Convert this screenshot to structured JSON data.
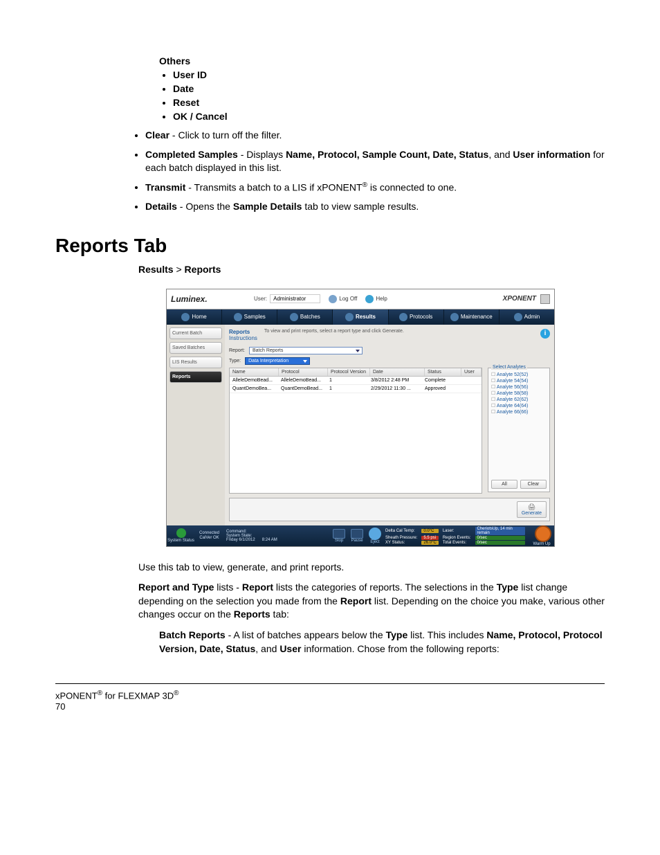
{
  "others": {
    "heading": "Others",
    "items": [
      "User ID",
      "Date",
      "Reset",
      "OK / Cancel"
    ]
  },
  "bullets": {
    "clear_label": "Clear",
    "clear_text": " - Click to turn off the filter.",
    "completed_label": "Completed Samples",
    "completed_pre": " - Displays ",
    "completed_fields": "Name, Protocol, Sample Count, Date, Status",
    "completed_and": ", and ",
    "completed_userinfo": "User information",
    "completed_tail": " for each batch displayed in this list.",
    "transmit_label": "Transmit",
    "transmit_pre": " - Transmits a batch to a LIS if xPONENT",
    "transmit_tail": " is connected to one.",
    "details_label": "Details",
    "details_pre": " - Opens the ",
    "details_tab": "Sample Details",
    "details_tail": " tab to view sample results."
  },
  "heading": "Reports Tab",
  "breadcrumb": {
    "a": "Results",
    "sep": " > ",
    "b": "Reports"
  },
  "app": {
    "logo": "Luminex",
    "user_label": "User:",
    "user_value": "Administrator",
    "logoff": "Log Off",
    "help": "Help",
    "brand": "XPONENT",
    "tabs": [
      "Home",
      "Samples",
      "Batches",
      "Results",
      "Protocols",
      "Maintenance",
      "Admin"
    ],
    "active_tab_index": 3,
    "sidebar": [
      "Current Batch",
      "Saved Batches",
      "LIS Results",
      "Reports"
    ],
    "active_side_index": 3,
    "instructions_title": "Reports",
    "instructions_sub": "Instructions",
    "instructions_text": "To view and print reports, select a report type and click Generate.",
    "report_label": "Report:",
    "report_value": "Batch Reports",
    "type_label": "Type:",
    "type_value": "Data Interpretation",
    "columns": [
      "Name",
      "Protocol",
      "Protocol Version",
      "Date",
      "Status",
      "User"
    ],
    "rows": [
      {
        "name": "AlleleDemoBead...",
        "protocol": "AlleleDemoBead...",
        "ver": "1",
        "date": "3/8/2012 2:48 PM",
        "status": "Complete",
        "user": ""
      },
      {
        "name": "QuantDemoBea...",
        "protocol": "QuantDemoBead...",
        "ver": "1",
        "date": "2/29/2012 11:30 ...",
        "status": "Approved",
        "user": ""
      }
    ],
    "analytes_title": "Select Analytes",
    "analytes": [
      "Analyte 52(52)",
      "Analyte 54(54)",
      "Analyte 56(56)",
      "Analyte 58(58)",
      "Analyte 62(62)",
      "Analyte 64(64)",
      "Analyte 66(66)"
    ],
    "btn_all": "All",
    "btn_clear": "Clear",
    "btn_generate": "Generate",
    "status": {
      "system_status": "System Status",
      "connected": "Connected",
      "calver": "CalVer OK",
      "command": "Command:",
      "sysstate": "System State:",
      "date": "Friday 6/1/2012",
      "time": "8:24 AM",
      "stop": "Stop",
      "pause": "Pause",
      "eject": "Eject",
      "delta": "Delta Cal Temp:",
      "delta_v": "0.0°C",
      "sheath": "Sheath Pressure:",
      "sheath_v": "5.5 psi",
      "xy": "XY Status:",
      "xy_v": "26.0°C",
      "laser": "Laser:",
      "laser_v": "CheriotsUp, 14 min remain",
      "region": "Region Events:",
      "region_v": "0/sec",
      "total": "Total Events:",
      "total_v": "0/sec",
      "warmup": "Warm Up"
    }
  },
  "post_text": {
    "p1": "Use this tab to view, generate, and print reports.",
    "p2a": "Report and Type",
    "p2b": " lists - ",
    "p2c": "Report",
    "p2d": " lists the categories of reports. The selections in the ",
    "p2e": "Type",
    "p2f": " list change depending on the selection you made from the ",
    "p2g": "Report",
    "p2h": " list. Depending on the choice you make, various other changes occur on the ",
    "p2i": "Reports",
    "p2j": " tab:",
    "p3a": "Batch Reports",
    "p3b": " - A list of batches appears below the ",
    "p3c": "Type",
    "p3d": " list. This includes ",
    "p3e": "Name, Protocol, Protocol Version, Date, Status",
    "p3f": ", and ",
    "p3g": "User",
    "p3h": " information. Chose from the following reports:"
  },
  "footer": {
    "line1a": "xPONENT",
    "line1b": " for FLEXMAP 3D",
    "pagenum": "70"
  }
}
